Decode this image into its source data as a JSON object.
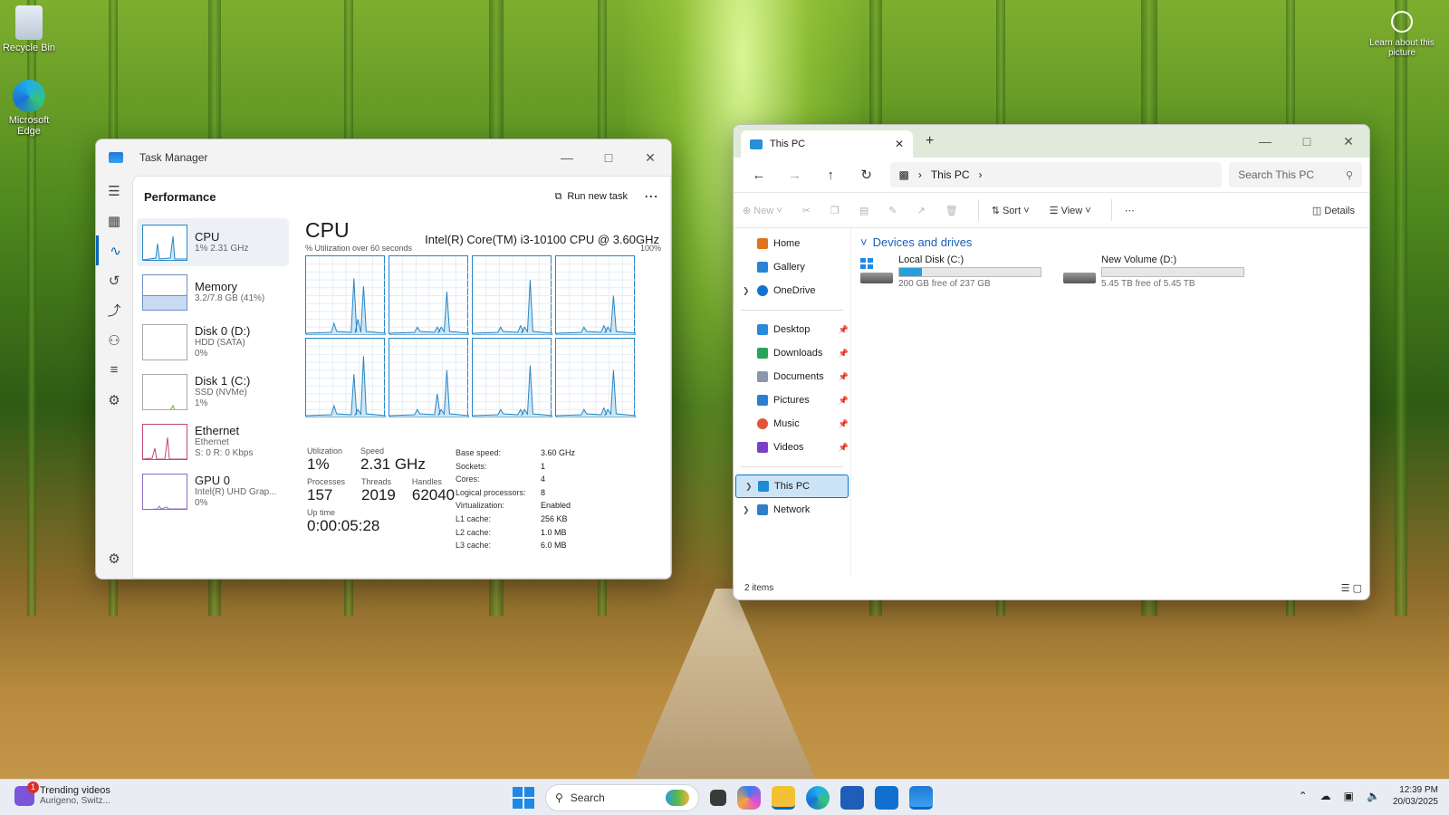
{
  "desktop": {
    "icons": [
      {
        "label": "Recycle Bin"
      },
      {
        "label": "Microsoft Edge"
      }
    ],
    "learn_label": "Learn about this picture"
  },
  "task_manager": {
    "title": "Task Manager",
    "section": "Performance",
    "run_new_task": "Run new task",
    "rail_icons": [
      "hamburger-icon",
      "processes-icon",
      "performance-icon",
      "app-history-icon",
      "startup-icon",
      "users-icon",
      "details-icon",
      "services-icon",
      "settings-icon"
    ],
    "side": [
      {
        "name": "CPU",
        "line2": "1% 2.31 GHz",
        "line3": ""
      },
      {
        "name": "Memory",
        "line2": "3.2/7.8 GB (41%)",
        "line3": ""
      },
      {
        "name": "Disk 0 (D:)",
        "line2": "HDD (SATA)",
        "line3": "0%"
      },
      {
        "name": "Disk 1 (C:)",
        "line2": "SSD (NVMe)",
        "line3": "1%"
      },
      {
        "name": "Ethernet",
        "line2": "Ethernet",
        "line3": "S: 0 R: 0 Kbps"
      },
      {
        "name": "GPU 0",
        "line2": "Intel(R) UHD Grap...",
        "line3": "0%"
      }
    ],
    "cpu": {
      "heading": "CPU",
      "model": "Intel(R) Core(TM) i3-10100 CPU @ 3.60GHz",
      "util_label": "% Utilization over 60 seconds",
      "max_label": "100%",
      "utilization_label": "Utilization",
      "utilization": "1%",
      "speed_label": "Speed",
      "speed": "2.31 GHz",
      "processes_label": "Processes",
      "processes": "157",
      "threads_label": "Threads",
      "threads": "2019",
      "handles_label": "Handles",
      "handles": "62040",
      "uptime_label": "Up time",
      "uptime": "0:00:05:28",
      "specs": [
        {
          "k": "Base speed:",
          "v": "3.60 GHz"
        },
        {
          "k": "Sockets:",
          "v": "1"
        },
        {
          "k": "Cores:",
          "v": "4"
        },
        {
          "k": "Logical processors:",
          "v": "8"
        },
        {
          "k": "Virtualization:",
          "v": "Enabled"
        },
        {
          "k": "L1 cache:",
          "v": "256 KB"
        },
        {
          "k": "L2 cache:",
          "v": "1.0 MB"
        },
        {
          "k": "L3 cache:",
          "v": "6.0 MB"
        }
      ],
      "core_spikes": [
        [
          0.15,
          0.72,
          0.2,
          0.62
        ],
        [
          0.1,
          0.1,
          0.1,
          0.55
        ],
        [
          0.1,
          0.12,
          0.1,
          0.7
        ],
        [
          0.1,
          0.12,
          0.1,
          0.5
        ],
        [
          0.15,
          0.55,
          0.1,
          0.78
        ],
        [
          0.1,
          0.3,
          0.1,
          0.6
        ],
        [
          0.1,
          0.1,
          0.1,
          0.66
        ],
        [
          0.1,
          0.12,
          0.1,
          0.6
        ]
      ],
      "accent": "#2a86c4"
    }
  },
  "explorer": {
    "tab_title": "This PC",
    "breadcrumb": "This PC",
    "search_placeholder": "Search This PC",
    "commands": {
      "new": "New",
      "sort": "Sort",
      "view": "View",
      "details": "Details"
    },
    "nav": [
      {
        "label": "Home",
        "pinned": false
      },
      {
        "label": "Gallery",
        "pinned": false
      },
      {
        "label": "OneDrive",
        "pinned": false
      },
      {
        "label": "Desktop",
        "pinned": true
      },
      {
        "label": "Downloads",
        "pinned": true
      },
      {
        "label": "Documents",
        "pinned": true
      },
      {
        "label": "Pictures",
        "pinned": true
      },
      {
        "label": "Music",
        "pinned": true
      },
      {
        "label": "Videos",
        "pinned": true
      },
      {
        "label": "This PC",
        "pinned": false
      },
      {
        "label": "Network",
        "pinned": false
      }
    ],
    "group_label": "Devices and drives",
    "drives": [
      {
        "name": "Local Disk (C:)",
        "free": "200 GB free of 237 GB",
        "used_fraction": 0.16
      },
      {
        "name": "New Volume (D:)",
        "free": "5.45 TB free of 5.45 TB",
        "used_fraction": 0.0
      }
    ],
    "status": "2 items"
  },
  "taskbar": {
    "widget_title": "Trending videos",
    "widget_sub": "Aurigeno, Switz...",
    "widget_badge": "1",
    "search_label": "Search",
    "time": "12:39 PM",
    "date": "20/03/2025"
  }
}
